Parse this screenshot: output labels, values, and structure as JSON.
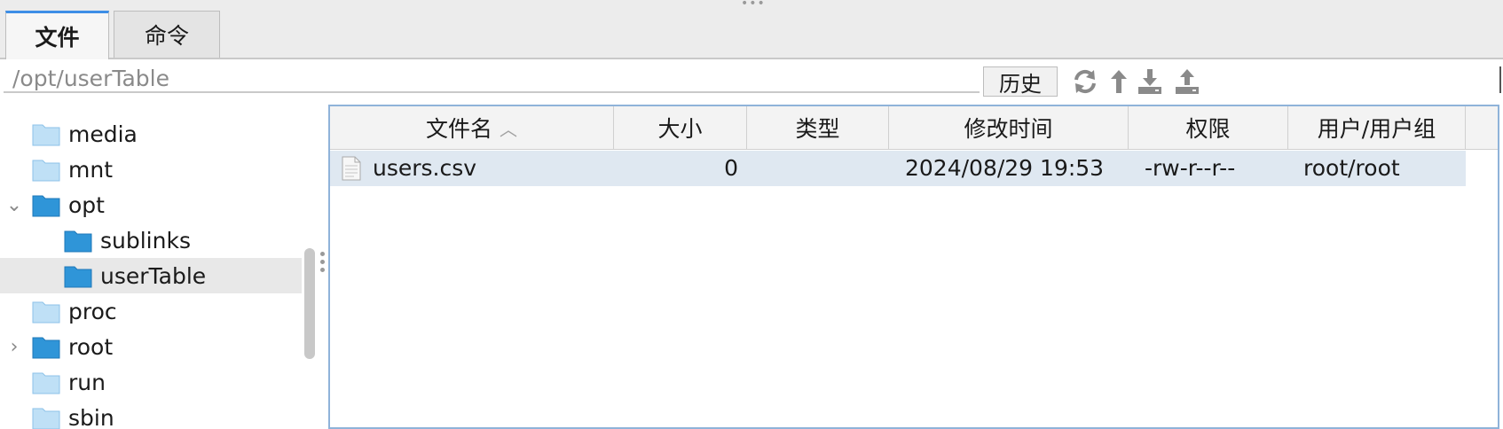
{
  "tabs": [
    {
      "label": "文件",
      "active": true
    },
    {
      "label": "命令",
      "active": false
    }
  ],
  "pathbar": {
    "path": "/opt/userTable",
    "history_label": "历史",
    "icons": [
      "refresh-icon",
      "up-arrow-icon",
      "download-icon",
      "upload-icon"
    ]
  },
  "tree": {
    "items": [
      {
        "label": "media",
        "level": 1,
        "folder": "light"
      },
      {
        "label": "mnt",
        "level": 1,
        "folder": "light"
      },
      {
        "label": "opt",
        "level": 1,
        "folder": "blue",
        "expanded": true
      },
      {
        "label": "sublinks",
        "level": 2,
        "folder": "blue"
      },
      {
        "label": "userTable",
        "level": 2,
        "folder": "blue",
        "selected": true
      },
      {
        "label": "proc",
        "level": 1,
        "folder": "light"
      },
      {
        "label": "root",
        "level": 1,
        "folder": "blue",
        "collapsed": true
      },
      {
        "label": "run",
        "level": 1,
        "folder": "light"
      },
      {
        "label": "sbin",
        "level": 1,
        "folder": "light"
      }
    ]
  },
  "table": {
    "columns": [
      "文件名",
      "大小",
      "类型",
      "修改时间",
      "权限",
      "用户/用户组"
    ],
    "sorted_column": "文件名",
    "sort_direction": "ascending",
    "rows": [
      {
        "name": "users.csv",
        "size": "0",
        "type": "",
        "modified": "2024/08/29 19:53",
        "permissions": "-rw-r--r--",
        "owner": "root/root",
        "selected": true
      }
    ]
  },
  "colors": {
    "accent": "#3d8ee6",
    "selection": "#dfe8f1",
    "folder_blue": "#2f95d8",
    "folder_light": "#bfe0f6"
  }
}
